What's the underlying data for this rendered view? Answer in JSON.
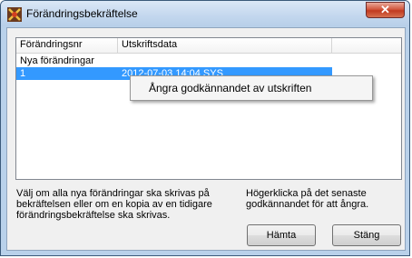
{
  "window": {
    "title": "Förändringsbekräftelse",
    "close_glyph": "✕"
  },
  "list": {
    "columns": [
      "Förändringsnr",
      "Utskriftsdata"
    ],
    "rows": [
      {
        "nr": "Nya förändringar",
        "data": ""
      },
      {
        "nr": "1",
        "data": "2012-07-03 14:04 SYS",
        "selected": true
      }
    ]
  },
  "context_menu": {
    "items": [
      "Ångra godkännandet av utskriften"
    ]
  },
  "help": {
    "left": "Välj om alla nya förändringar ska skrivas på bekräftelsen eller om en kopia av en tidigare förändringsbekräftelse ska skrivas.",
    "right": "Högerklicka på det senaste godkännandet för att ångra."
  },
  "buttons": {
    "get": "Hämta",
    "close": "Stäng"
  },
  "colors": {
    "selection": "#3399ff",
    "dialog_bg": "#f0f0f0"
  }
}
